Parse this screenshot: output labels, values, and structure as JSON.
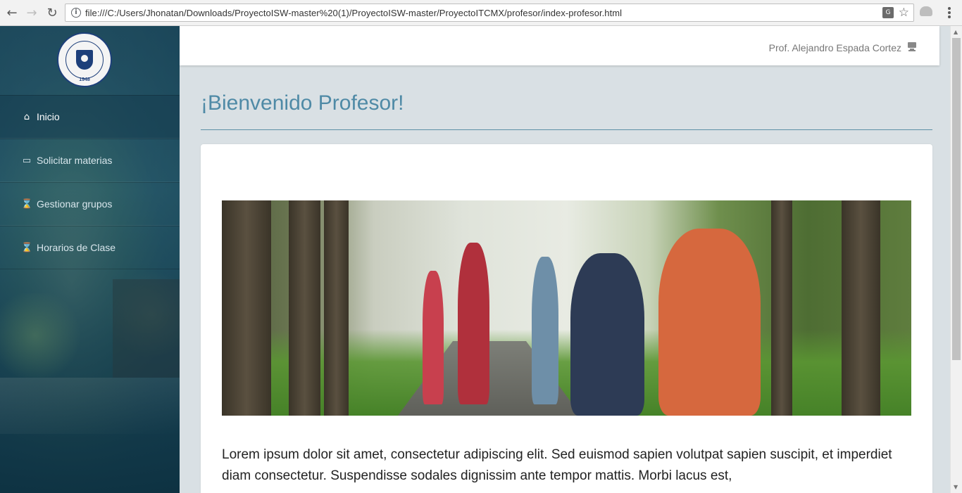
{
  "browser": {
    "url": "file:///C:/Users/Jhonatan/Downloads/ProyectoISW-master%20(1)/ProyectoISW-master/ProyectoITCMX/profesor/index-profesor.html",
    "back_icon": "arrow-left-icon",
    "forward_icon": "arrow-right-icon",
    "reload_icon": "reload-icon",
    "info_icon": "info-icon",
    "translate_icon": "translate-icon",
    "bookmark_icon": "star-icon",
    "menu_icon": "kebab-menu-icon"
  },
  "logo": {
    "year": "1948"
  },
  "sidebar": {
    "items": [
      {
        "label": "Inicio",
        "icon": "home-icon",
        "active": true
      },
      {
        "label": "Solicitar materias",
        "icon": "monitor-icon",
        "active": false
      },
      {
        "label": "Gestionar grupos",
        "icon": "hourglass-icon",
        "active": false
      },
      {
        "label": "Horarios de Clase",
        "icon": "hourglass-icon",
        "active": false
      }
    ]
  },
  "header": {
    "user_name": "Prof. Alejandro Espada Cortez",
    "user_icon": "monitor-icon"
  },
  "main": {
    "title": "¡Bienvenido Profesor!",
    "hero_image": "students-walking-campus-photo",
    "body_text": "Lorem ipsum dolor sit amet, consectetur adipiscing elit. Sed euismod sapien volutpat sapien suscipit, et imperdiet diam consectetur. Suspendisse sodales dignissim ante tempor mattis. Morbi lacus est,"
  },
  "colors": {
    "title": "#4f8aa6",
    "main_bg": "#d9e0e4",
    "sidebar": "#1e4656"
  }
}
